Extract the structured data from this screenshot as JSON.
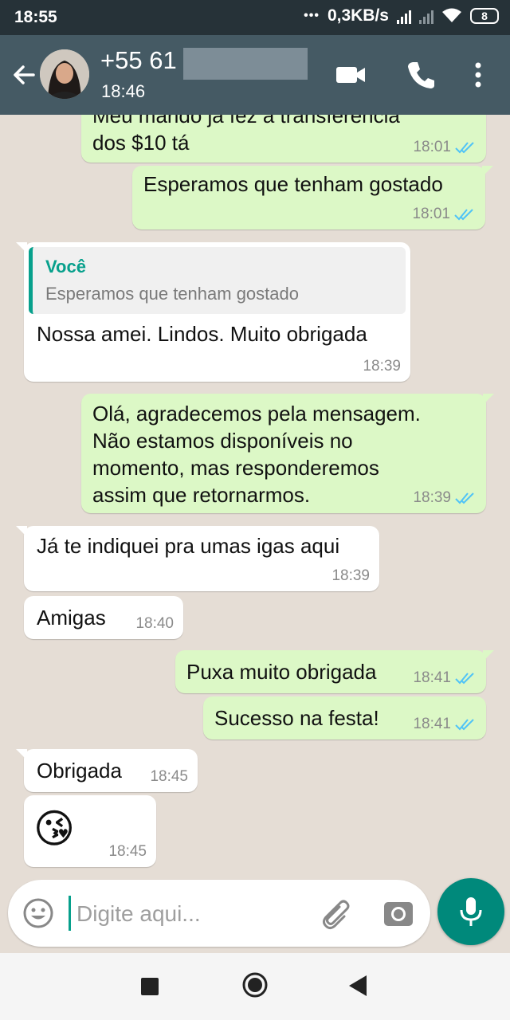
{
  "status_bar": {
    "time": "18:55",
    "dots": "•••",
    "network_speed": "0,3KB/s",
    "battery": "8"
  },
  "header": {
    "contact_name": "+55 61",
    "contact_status": "18:46",
    "icons": [
      "back-arrow-icon",
      "avatar",
      "video-call-icon",
      "phone-icon",
      "more-vert-icon"
    ]
  },
  "messages": [
    {
      "dir": "out",
      "lines": [
        "Meu marido já fez a transferência",
        "dos $10 tá"
      ],
      "time": "18:01",
      "ticks": "read"
    },
    {
      "dir": "out",
      "lines": [
        "Esperamos que tenham gostado"
      ],
      "time": "18:01",
      "ticks": "read"
    },
    {
      "dir": "in",
      "quote_author": "Você",
      "quote_text": "Esperamos que tenham gostado",
      "lines": [
        "Nossa amei. Lindos. Muito obrigada"
      ],
      "time": "18:39"
    },
    {
      "dir": "out",
      "lines": [
        "Olá, agradecemos pela mensagem.",
        "Não estamos disponíveis no",
        "momento, mas responderemos",
        "assim que retornarmos."
      ],
      "time": "18:39",
      "ticks": "read"
    },
    {
      "dir": "in",
      "lines": [
        "Já te indiquei pra umas igas aqui"
      ],
      "time": "18:39"
    },
    {
      "dir": "in",
      "lines": [
        "Amigas"
      ],
      "time": "18:40"
    },
    {
      "dir": "out",
      "lines": [
        "Puxa muito obrigada"
      ],
      "time": "18:41",
      "ticks": "read"
    },
    {
      "dir": "out",
      "lines": [
        "Sucesso na festa!"
      ],
      "time": "18:41",
      "ticks": "read"
    },
    {
      "dir": "in",
      "lines": [
        "Obrigada"
      ],
      "time": "18:45"
    },
    {
      "dir": "in",
      "emoji": "😘",
      "time": "18:45"
    }
  ],
  "input": {
    "placeholder": "Digite aqui..."
  },
  "colors": {
    "header": "#455a64",
    "status_bar": "#263238",
    "chat_bg": "#e5ddd5",
    "outgoing_bubble": "#dcf8c6",
    "incoming_bubble": "#ffffff",
    "accent": "#07a08c",
    "read_ticks": "#4fc3f7",
    "mic_button": "#00897b"
  }
}
